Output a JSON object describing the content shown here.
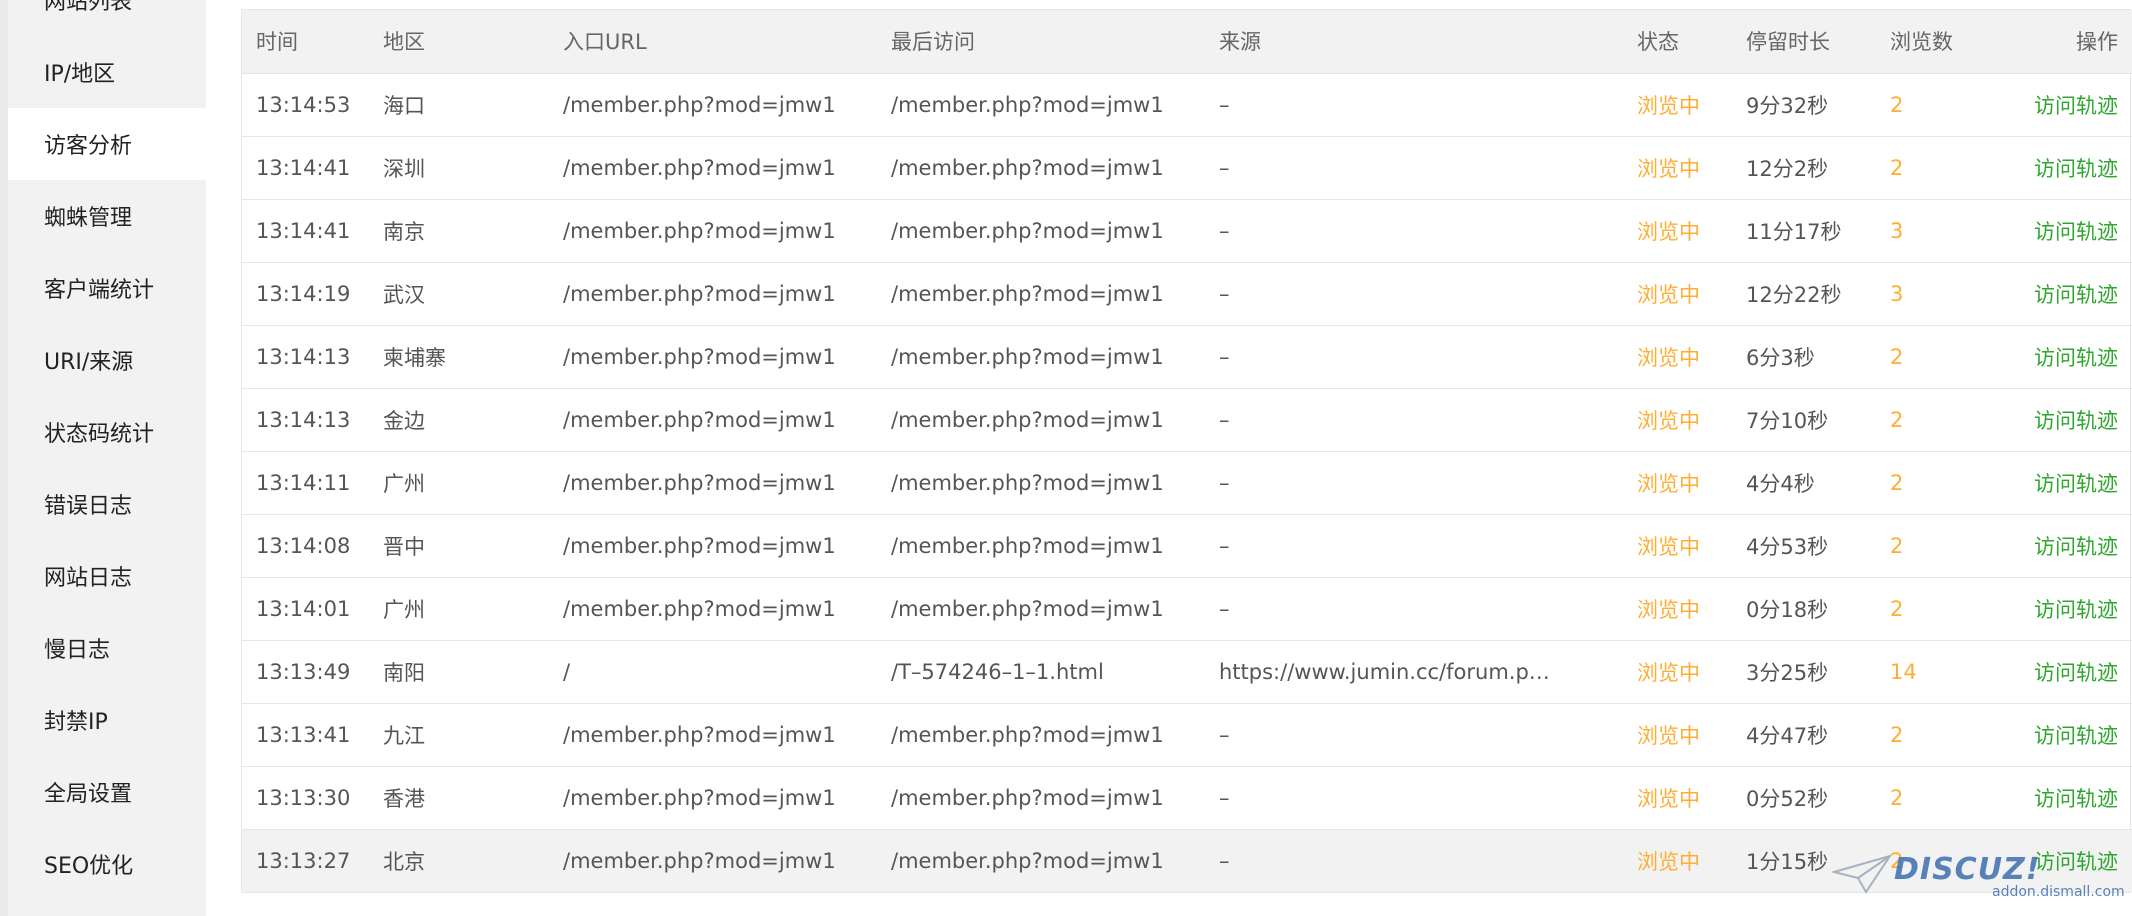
{
  "sidebar": {
    "items": [
      {
        "label": "网站列表"
      },
      {
        "label": "IP/地区"
      },
      {
        "label": "访客分析"
      },
      {
        "label": "蜘蛛管理"
      },
      {
        "label": "客户端统计"
      },
      {
        "label": "URI/来源"
      },
      {
        "label": "状态码统计"
      },
      {
        "label": "错误日志"
      },
      {
        "label": "网站日志"
      },
      {
        "label": "慢日志"
      },
      {
        "label": "封禁IP"
      },
      {
        "label": "全局设置"
      },
      {
        "label": "SEO优化"
      }
    ],
    "active_label": "访客分析"
  },
  "table": {
    "headers": {
      "time": "时间",
      "region": "地区",
      "entry_url": "入口URL",
      "last_visit": "最后访问",
      "source": "来源",
      "status": "状态",
      "duration": "停留时长",
      "views": "浏览数",
      "action": "操作"
    },
    "rows": [
      {
        "time": "13:14:53",
        "region": "海口",
        "entry_url": "/member.php?mod=jmw1",
        "last_visit": "/member.php?mod=jmw1",
        "source": "–",
        "status": "浏览中",
        "duration": "9分32秒",
        "views": "2",
        "action": "访问轨迹"
      },
      {
        "time": "13:14:41",
        "region": "深圳",
        "entry_url": "/member.php?mod=jmw1",
        "last_visit": "/member.php?mod=jmw1",
        "source": "–",
        "status": "浏览中",
        "duration": "12分2秒",
        "views": "2",
        "action": "访问轨迹"
      },
      {
        "time": "13:14:41",
        "region": "南京",
        "entry_url": "/member.php?mod=jmw1",
        "last_visit": "/member.php?mod=jmw1",
        "source": "–",
        "status": "浏览中",
        "duration": "11分17秒",
        "views": "3",
        "action": "访问轨迹"
      },
      {
        "time": "13:14:19",
        "region": "武汉",
        "entry_url": "/member.php?mod=jmw1",
        "last_visit": "/member.php?mod=jmw1",
        "source": "–",
        "status": "浏览中",
        "duration": "12分22秒",
        "views": "3",
        "action": "访问轨迹"
      },
      {
        "time": "13:14:13",
        "region": "柬埔寨",
        "entry_url": "/member.php?mod=jmw1",
        "last_visit": "/member.php?mod=jmw1",
        "source": "–",
        "status": "浏览中",
        "duration": "6分3秒",
        "views": "2",
        "action": "访问轨迹"
      },
      {
        "time": "13:14:13",
        "region": "金边",
        "entry_url": "/member.php?mod=jmw1",
        "last_visit": "/member.php?mod=jmw1",
        "source": "–",
        "status": "浏览中",
        "duration": "7分10秒",
        "views": "2",
        "action": "访问轨迹"
      },
      {
        "time": "13:14:11",
        "region": "广州",
        "entry_url": "/member.php?mod=jmw1",
        "last_visit": "/member.php?mod=jmw1",
        "source": "–",
        "status": "浏览中",
        "duration": "4分4秒",
        "views": "2",
        "action": "访问轨迹"
      },
      {
        "time": "13:14:08",
        "region": "晋中",
        "entry_url": "/member.php?mod=jmw1",
        "last_visit": "/member.php?mod=jmw1",
        "source": "–",
        "status": "浏览中",
        "duration": "4分53秒",
        "views": "2",
        "action": "访问轨迹"
      },
      {
        "time": "13:14:01",
        "region": "广州",
        "entry_url": "/member.php?mod=jmw1",
        "last_visit": "/member.php?mod=jmw1",
        "source": "–",
        "status": "浏览中",
        "duration": "0分18秒",
        "views": "2",
        "action": "访问轨迹"
      },
      {
        "time": "13:13:49",
        "region": "南阳",
        "entry_url": "/",
        "last_visit": "/T–574246–1–1.html",
        "source": "https://www.jumin.cc/forum.p…",
        "status": "浏览中",
        "duration": "3分25秒",
        "views": "14",
        "action": "访问轨迹"
      },
      {
        "time": "13:13:41",
        "region": "九江",
        "entry_url": "/member.php?mod=jmw1",
        "last_visit": "/member.php?mod=jmw1",
        "source": "–",
        "status": "浏览中",
        "duration": "4分47秒",
        "views": "2",
        "action": "访问轨迹"
      },
      {
        "time": "13:13:30",
        "region": "香港",
        "entry_url": "/member.php?mod=jmw1",
        "last_visit": "/member.php?mod=jmw1",
        "source": "–",
        "status": "浏览中",
        "duration": "0分52秒",
        "views": "2",
        "action": "访问轨迹"
      },
      {
        "time": "13:13:27",
        "region": "北京",
        "entry_url": "/member.php?mod=jmw1",
        "last_visit": "/member.php?mod=jmw1",
        "source": "–",
        "status": "浏览中",
        "duration": "1分15秒",
        "views": "2",
        "action": "访问轨迹"
      }
    ]
  },
  "watermark": {
    "brand": "DISCUZ!",
    "sub": "addon.dismall.com"
  },
  "colors": {
    "status": "#ffad33",
    "action": "#2fa62f",
    "header_bg": "#f2f2f2"
  }
}
